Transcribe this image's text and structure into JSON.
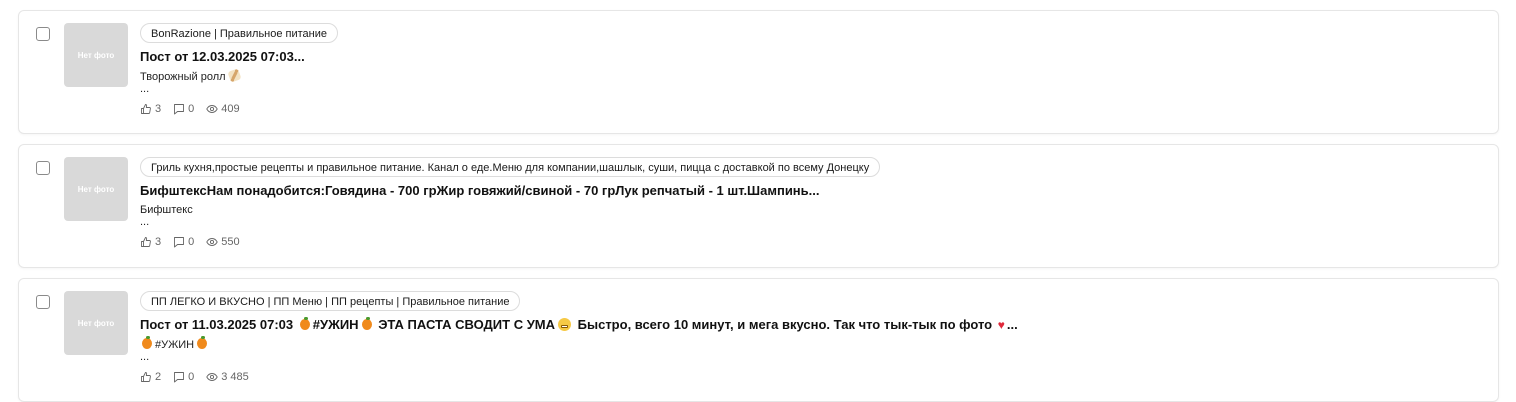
{
  "posts": [
    {
      "thumbnail_text": "Нет фото",
      "channel": "BonRazione | Правильное питание",
      "title": "Пост от 12.03.2025 07:03...",
      "excerpt": "Творожный ролл",
      "excerpt_emoji": "roll-emoji",
      "ellipsis": "...",
      "likes": "3",
      "comments": "0",
      "views": "409"
    },
    {
      "thumbnail_text": "Нет фото",
      "channel": "Гриль кухня,простые рецепты и правильное питание. Канал о еде.Меню для компании,шашлык, суши, пицца с доставкой по всему Донецку",
      "title": "БифштексНам понадобится:Говядина - 700 грЖир говяжий/свиной - 70 грЛук репчатый - 1 шт.Шампинь...",
      "excerpt": "Бифштекс",
      "ellipsis": "...",
      "likes": "3",
      "comments": "0",
      "views": "550"
    },
    {
      "thumbnail_text": "Нет фото",
      "channel": "ПП ЛЕГКО И ВКУСНО | ПП Меню | ПП рецепты | Правильное питание",
      "title_parts": {
        "p1": "Пост от 11.03.2025 07:03",
        "p2": "#УЖИН",
        "p3": "ЭТА ПАСТА СВОДИТ С УМА",
        "p4": "Быстро, всего 10 минут, и мега вкусно. Так что тык-тык по фото",
        "p5": "..."
      },
      "excerpt": "#УЖИН",
      "ellipsis": "...",
      "likes": "2",
      "comments": "0",
      "views": "3 485"
    }
  ],
  "colors": {
    "thumbnail_bg": "#d9d9d9",
    "card_border": "#e6e6e6",
    "stat_text": "#666666"
  }
}
